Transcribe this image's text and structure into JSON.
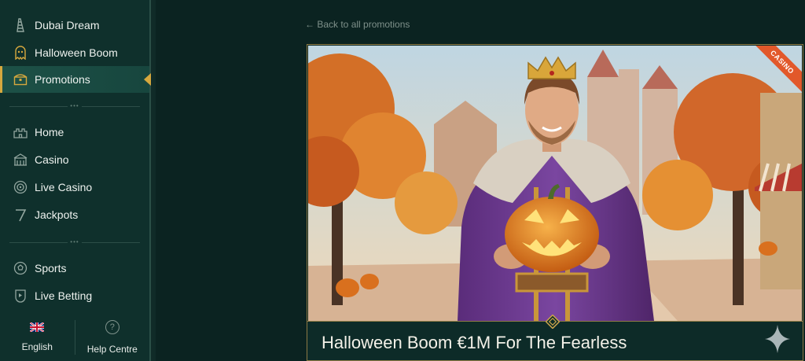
{
  "sidebar": {
    "top_items": [
      {
        "label": "Dubai Dream",
        "icon": "tower-icon"
      },
      {
        "label": "Halloween Boom",
        "icon": "ghost-icon"
      },
      {
        "label": "Promotions",
        "icon": "treasure-chest-icon",
        "active": true
      }
    ],
    "main_items": [
      {
        "label": "Home",
        "icon": "castle-icon"
      },
      {
        "label": "Casino",
        "icon": "casino-building-icon"
      },
      {
        "label": "Live Casino",
        "icon": "roulette-icon"
      },
      {
        "label": "Jackpots",
        "icon": "seven-icon"
      }
    ],
    "sport_items": [
      {
        "label": "Sports",
        "icon": "soccer-ball-icon"
      },
      {
        "label": "Live Betting",
        "icon": "live-betting-icon"
      }
    ],
    "footer": {
      "language_label": "English",
      "help_label": "Help Centre",
      "help_glyph": "?"
    }
  },
  "main": {
    "back_link": "← Back to all promotions",
    "promotion": {
      "title": "Halloween Boom €1M For The Fearless",
      "ribbon": "CASINO"
    }
  },
  "colors": {
    "accent_gold": "#d6a83e",
    "sidebar_bg": "#0f302c",
    "page_bg": "#0b2321",
    "ribbon": "#e2582a"
  }
}
